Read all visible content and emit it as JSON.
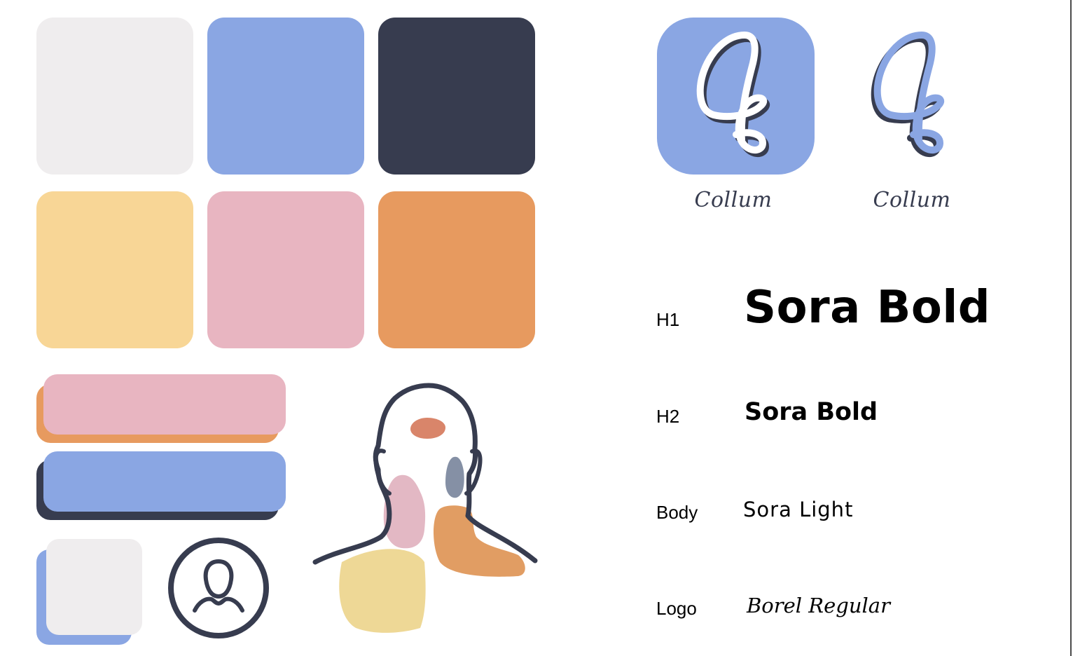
{
  "palette": {
    "swatches": [
      {
        "name": "light-gray",
        "color": "#efedee"
      },
      {
        "name": "periwinkle-blue",
        "color": "#8aa6e3"
      },
      {
        "name": "navy",
        "color": "#373c4f"
      },
      {
        "name": "butter-yellow",
        "color": "#f8d696"
      },
      {
        "name": "blush-pink",
        "color": "#e8b5c1"
      },
      {
        "name": "tangerine",
        "color": "#e79a5f"
      }
    ]
  },
  "components": {
    "pink_bar": {
      "front": "#e8b5c1",
      "shadow": "#e79a5f"
    },
    "blue_bar": {
      "front": "#8aa6e3",
      "shadow": "#373c4f"
    },
    "card": {
      "front": "#efedee",
      "shadow": "#8aa6e3"
    },
    "avatar": {
      "icon": "user-avatar-icon",
      "stroke": "#373c4f"
    }
  },
  "illustration": {
    "icon": "neck-illustration",
    "outline": "#373c4f",
    "blobs": [
      "#d9856a",
      "#e3b8c4",
      "#8590a5",
      "#e19d63",
      "#eed896"
    ]
  },
  "logos": {
    "app_icon": {
      "tile_color": "#8aa6e3",
      "stroke": "#ffffff",
      "shadow": "#373c4f"
    },
    "mark": {
      "stroke": "#8aa6e3",
      "shadow": "#373c4f"
    },
    "wordmark_1": "Collum",
    "wordmark_2": "Collum",
    "wordmark_color": "#373c4f"
  },
  "typography": [
    {
      "label": "H1",
      "sample": "Sora Bold"
    },
    {
      "label": "H2",
      "sample": "Sora Bold"
    },
    {
      "label": "Body",
      "sample": "Sora Light"
    },
    {
      "label": "Logo",
      "sample": "Borel Regular"
    }
  ]
}
